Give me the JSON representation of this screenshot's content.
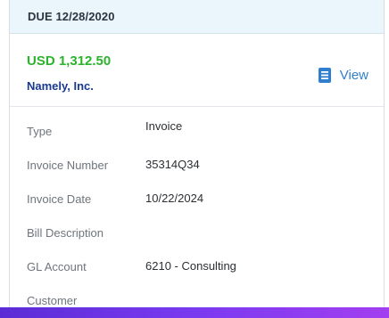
{
  "due": {
    "label": "DUE 12/28/2020"
  },
  "summary": {
    "amount": "USD 1,312.50",
    "vendor": "Namely, Inc.",
    "view_label": "View",
    "view_icon": "document-icon"
  },
  "details": [
    {
      "label": "Type",
      "value": "Invoice"
    },
    {
      "label": "Invoice Number",
      "value": "35314Q34"
    },
    {
      "label": "Invoice Date",
      "value": "10/22/2024"
    },
    {
      "label": "Bill Description",
      "value": ""
    },
    {
      "label": "GL Account",
      "value": "6210 - Consulting"
    },
    {
      "label": "Customer",
      "value": ""
    }
  ],
  "colors": {
    "amount": "#2bb32b",
    "vendor": "#1b3a8f",
    "link": "#2f7fd0",
    "header_bg": "#eaf6fb"
  }
}
